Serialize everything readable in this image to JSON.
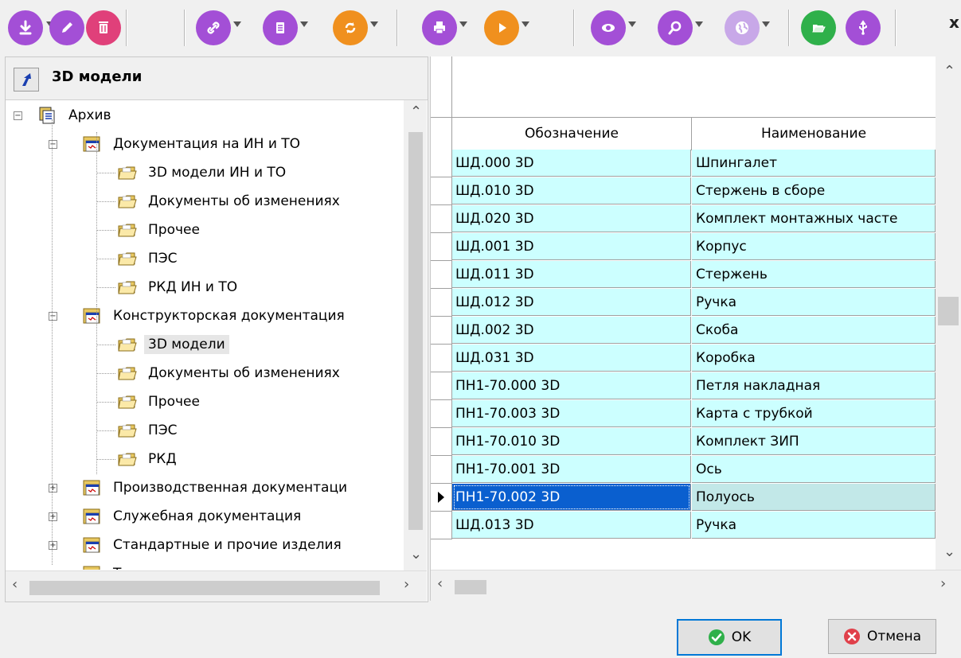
{
  "toolbar": {
    "buttons": [
      {
        "icon": "download-icon",
        "color": "#a34fd6",
        "dropdown": true
      },
      {
        "icon": "edit-icon",
        "color": "#a34fd6",
        "dropdown": false
      },
      {
        "icon": "delete-icon",
        "color": "#e0407a",
        "dropdown": false
      },
      {
        "icon": "link-icon",
        "color": "#a34fd6",
        "dropdown": true
      },
      {
        "icon": "document-icon",
        "color": "#a34fd6",
        "dropdown": true
      },
      {
        "icon": "refresh-icon",
        "color": "#f0901e",
        "dropdown": true
      },
      {
        "icon": "print-icon",
        "color": "#a34fd6",
        "dropdown": true
      },
      {
        "icon": "play-icon",
        "color": "#f0901e",
        "dropdown": true
      },
      {
        "icon": "view-icon",
        "color": "#a34fd6",
        "dropdown": true
      },
      {
        "icon": "search-icon",
        "color": "#a34fd6",
        "dropdown": true
      },
      {
        "icon": "globe-icon",
        "color": "#c8a8e8",
        "dropdown": true
      },
      {
        "icon": "open-folder-icon",
        "color": "#2fb04a",
        "dropdown": false
      },
      {
        "icon": "usb-icon",
        "color": "#a34fd6",
        "dropdown": false
      }
    ],
    "close_label": "x"
  },
  "left_panel": {
    "title": "3D модели",
    "tree": [
      {
        "label": "Архив",
        "level": 0,
        "expander": "minus",
        "icon": "archive-icon"
      },
      {
        "label": "Документация на ИН и ТО",
        "level": 1,
        "expander": "minus",
        "icon": "docs-icon"
      },
      {
        "label": "3D модели ИН и ТО",
        "level": 2,
        "icon": "folder-icon"
      },
      {
        "label": "Документы об изменениях",
        "level": 2,
        "icon": "folder-icon"
      },
      {
        "label": "Прочее",
        "level": 2,
        "icon": "folder-icon"
      },
      {
        "label": "ПЭС",
        "level": 2,
        "icon": "folder-icon"
      },
      {
        "label": "РКД ИН и ТО",
        "level": 2,
        "icon": "folder-icon"
      },
      {
        "label": "Конструкторская документация",
        "level": 1,
        "expander": "minus",
        "icon": "docs-icon"
      },
      {
        "label": "3D модели",
        "level": 2,
        "icon": "folder-icon",
        "selected": true
      },
      {
        "label": "Документы об изменениях",
        "level": 2,
        "icon": "folder-icon"
      },
      {
        "label": "Прочее",
        "level": 2,
        "icon": "folder-icon"
      },
      {
        "label": "ПЭС",
        "level": 2,
        "icon": "folder-icon"
      },
      {
        "label": "РКД",
        "level": 2,
        "icon": "folder-icon"
      },
      {
        "label": "Производственная документаци",
        "level": 1,
        "expander": "plus",
        "icon": "docs-icon"
      },
      {
        "label": "Служебная документация",
        "level": 1,
        "expander": "plus",
        "icon": "docs-icon"
      },
      {
        "label": "Стандартные и прочие изделия",
        "level": 1,
        "expander": "plus",
        "icon": "docs-icon"
      },
      {
        "label": "Т",
        "level": 1,
        "expander": "plus",
        "icon": "docs-icon"
      }
    ]
  },
  "grid": {
    "columns": [
      "Обозначение",
      "Наименование"
    ],
    "rows": [
      {
        "designation": "ШД.000 3D",
        "name": "Шпингалет"
      },
      {
        "designation": "ШД.010 3D",
        "name": "Стержень в сборе"
      },
      {
        "designation": "ШД.020 3D",
        "name": "Комплект монтажных часте"
      },
      {
        "designation": "ШД.001 3D",
        "name": "Корпус"
      },
      {
        "designation": "ШД.011 3D",
        "name": "Стержень"
      },
      {
        "designation": "ШД.012 3D",
        "name": "Ручка"
      },
      {
        "designation": "ШД.002 3D",
        "name": "Скоба"
      },
      {
        "designation": "ШД.031 3D",
        "name": "Коробка"
      },
      {
        "designation": "ПН1-70.000 3D",
        "name": "Петля накладная"
      },
      {
        "designation": "ПН1-70.003 3D",
        "name": "Карта с трубкой"
      },
      {
        "designation": "ПН1-70.010 3D",
        "name": "Комплект ЗИП"
      },
      {
        "designation": "ПН1-70.001 3D",
        "name": "Ось"
      },
      {
        "designation": "ПН1-70.002 3D",
        "name": "Полуось",
        "selected": true
      },
      {
        "designation": "ШД.013 3D",
        "name": "Ручка"
      }
    ]
  },
  "buttons": {
    "ok": "OK",
    "cancel": "Отмена"
  },
  "colors": {
    "cell_bg": "#ccffff",
    "selection": "#0a5fcf",
    "ok_icon": "#2fb04a",
    "cancel_icon": "#e0404a"
  }
}
